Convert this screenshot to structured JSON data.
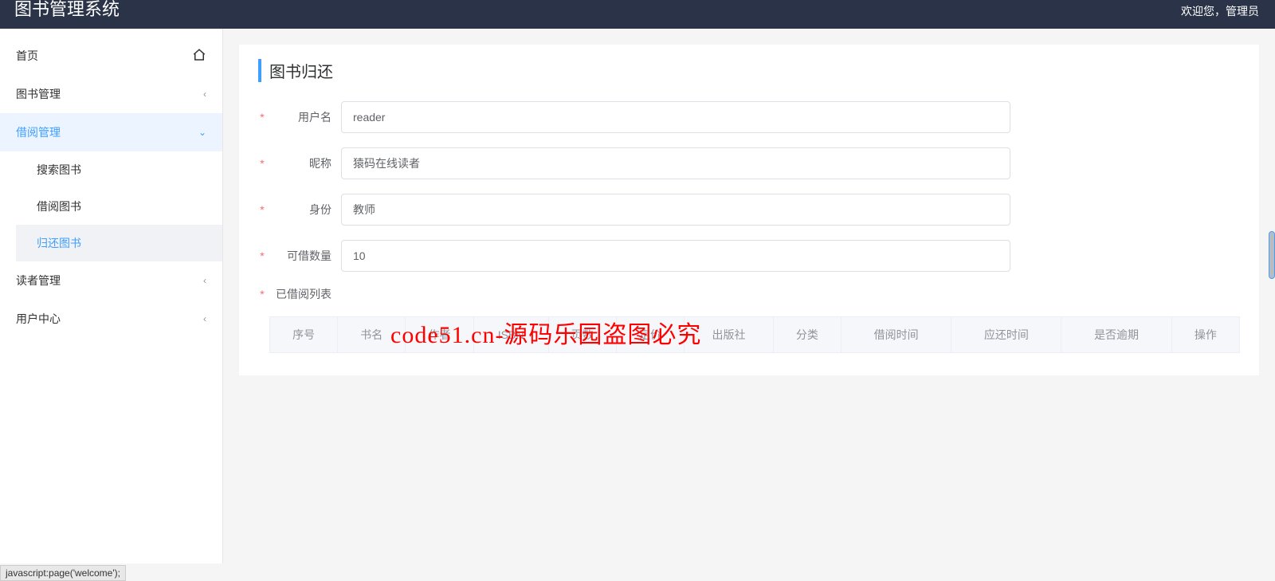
{
  "header": {
    "title": "图书管理系统",
    "welcome": "欢迎您，管理员"
  },
  "sidebar": {
    "home": "首页",
    "book_mgmt": "图书管理",
    "borrow_mgmt": "借阅管理",
    "borrow_sub": {
      "search": "搜索图书",
      "borrow": "借阅图书",
      "return": "归还图书"
    },
    "reader_mgmt": "读者管理",
    "user_center": "用户中心"
  },
  "page": {
    "title": "图书归还",
    "fields": {
      "username_label": "用户名",
      "username_value": "reader",
      "nickname_label": "昵称",
      "nickname_value": "猿码在线读者",
      "identity_label": "身份",
      "identity_value": "教师",
      "quota_label": "可借数量",
      "quota_value": "10",
      "borrowed_list_label": "已借阅列表"
    },
    "table_headers": {
      "idx": "序号",
      "name": "书名",
      "author": "作者",
      "isbn": "ISBN",
      "pages": "页数",
      "price": "定价",
      "publisher": "出版社",
      "category": "分类",
      "borrow_time": "借阅时间",
      "due_time": "应还时间",
      "overdue": "是否逾期",
      "action": "操作"
    }
  },
  "watermark": "code51.cn-源码乐园盗图必究",
  "status_bar": "javascript:page('welcome');"
}
